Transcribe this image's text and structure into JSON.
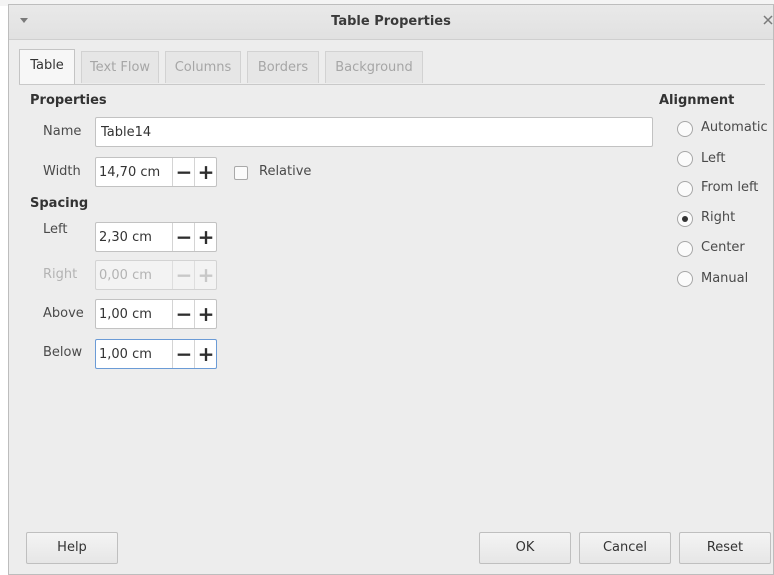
{
  "window": {
    "title": "Table Properties"
  },
  "tabs": [
    {
      "label": "Table",
      "active": true
    },
    {
      "label": "Text Flow",
      "active": false
    },
    {
      "label": "Columns",
      "active": false
    },
    {
      "label": "Borders",
      "active": false
    },
    {
      "label": "Background",
      "active": false
    }
  ],
  "properties": {
    "heading": "Properties",
    "name_label": "Name",
    "name_value": "Table14",
    "width_label": "Width",
    "width_value": "14,70 cm",
    "relative_label": "Relative",
    "relative_checked": false
  },
  "spacing": {
    "heading": "Spacing",
    "left_label": "Left",
    "left_value": "2,30 cm",
    "right_label": "Right",
    "right_value": "0,00 cm",
    "above_label": "Above",
    "above_value": "1,00 cm",
    "below_label": "Below",
    "below_value": "1,00 cm"
  },
  "spin_symbols": {
    "minus": "−",
    "plus": "+"
  },
  "alignment": {
    "heading": "Alignment",
    "options": [
      {
        "label": "Automatic",
        "checked": false
      },
      {
        "label": "Left",
        "checked": false
      },
      {
        "label": "From left",
        "checked": false
      },
      {
        "label": "Right",
        "checked": true
      },
      {
        "label": "Center",
        "checked": false
      },
      {
        "label": "Manual",
        "checked": false
      }
    ]
  },
  "buttons": {
    "help": "Help",
    "ok": "OK",
    "cancel": "Cancel",
    "reset": "Reset"
  }
}
